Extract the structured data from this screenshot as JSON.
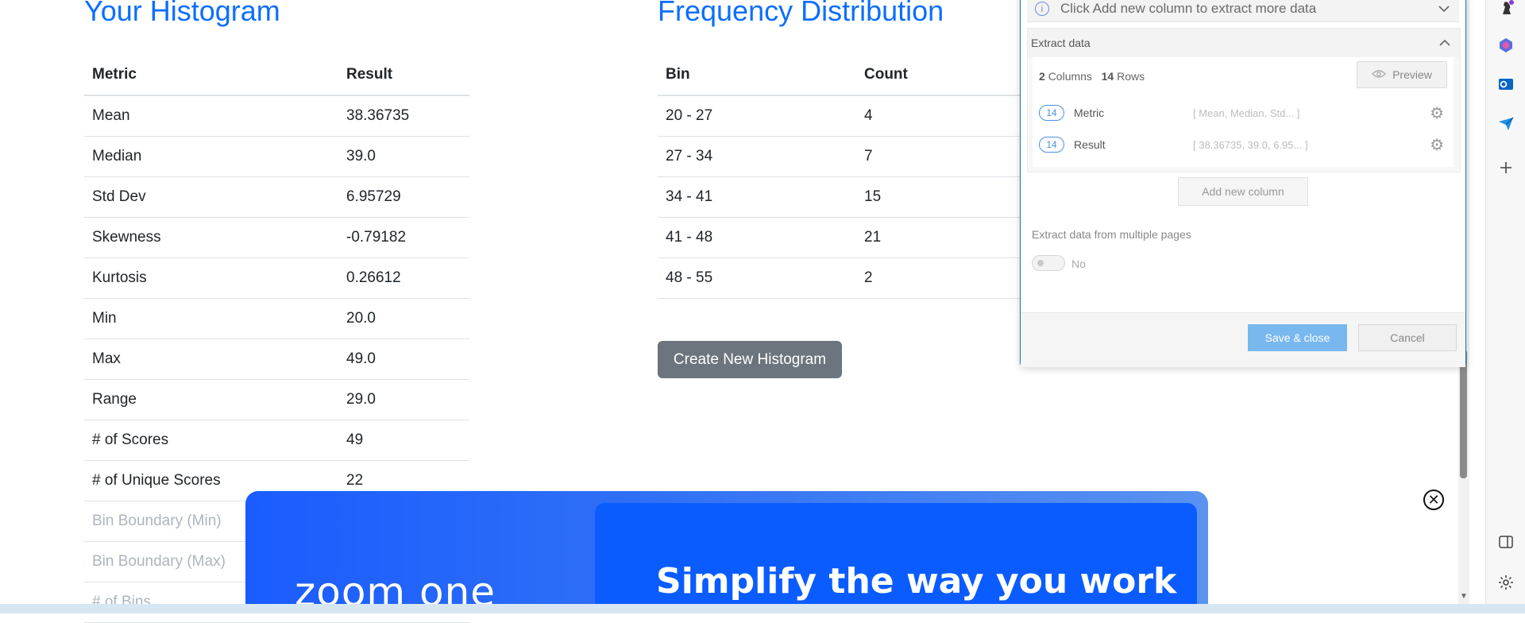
{
  "histogram": {
    "title": "Your Histogram",
    "headers": [
      "Metric",
      "Result"
    ],
    "rows": [
      {
        "metric": "Mean",
        "result": "38.36735"
      },
      {
        "metric": "Median",
        "result": "39.0"
      },
      {
        "metric": "Std Dev",
        "result": "6.95729"
      },
      {
        "metric": "Skewness",
        "result": "-0.79182"
      },
      {
        "metric": "Kurtosis",
        "result": "0.26612"
      },
      {
        "metric": "Min",
        "result": "20.0"
      },
      {
        "metric": "Max",
        "result": "49.0"
      },
      {
        "metric": "Range",
        "result": "29.0"
      },
      {
        "metric": "# of Scores",
        "result": "49"
      },
      {
        "metric": "# of Unique Scores",
        "result": "22"
      },
      {
        "metric": "Bin Boundary (Min)",
        "result": ""
      },
      {
        "metric": "Bin Boundary (Max)",
        "result": ""
      },
      {
        "metric": "# of Bins",
        "result": ""
      }
    ]
  },
  "distribution": {
    "title": "Frequency Distribution",
    "headers": [
      "Bin",
      "Count"
    ],
    "rows": [
      {
        "bin": "20 - 27",
        "count": "4"
      },
      {
        "bin": "27 - 34",
        "count": "7"
      },
      {
        "bin": "34 - 41",
        "count": "15"
      },
      {
        "bin": "41 - 48",
        "count": "21"
      },
      {
        "bin": "48 - 55",
        "count": "2"
      }
    ],
    "create_button": "Create New Histogram"
  },
  "ad": {
    "logo": "zoom one",
    "headline": "Simplify the way you work",
    "close_icon": "close-circle-icon"
  },
  "extract_panel": {
    "info_text": "Click Add new column to extract more data",
    "section_title": "Extract data",
    "columns_count": "2",
    "columns_label": "Columns",
    "rows_count": "14",
    "rows_label": "Rows",
    "preview_label": "Preview",
    "columns": [
      {
        "badge": "14",
        "name": "Metric",
        "values": "[ Mean, Median, Std... ]"
      },
      {
        "badge": "14",
        "name": "Result",
        "values": "[ 38.36735, 39.0, 6.95... ]"
      }
    ],
    "add_column_label": "Add new column",
    "multi_pages_label": "Extract data from multiple pages",
    "multi_pages_value": "No",
    "save_label": "Save & close",
    "cancel_label": "Cancel"
  },
  "sidebar": {
    "icons": [
      "chess-icon",
      "copilot-icon",
      "outlook-icon",
      "send-icon",
      "add-icon",
      "split-view-icon",
      "settings-icon"
    ]
  },
  "colors": {
    "accent_blue": "#0d6efd",
    "button_gray": "#6c757d",
    "save_blue": "#79b8ee",
    "zoom_blue": "#0b5cff"
  }
}
